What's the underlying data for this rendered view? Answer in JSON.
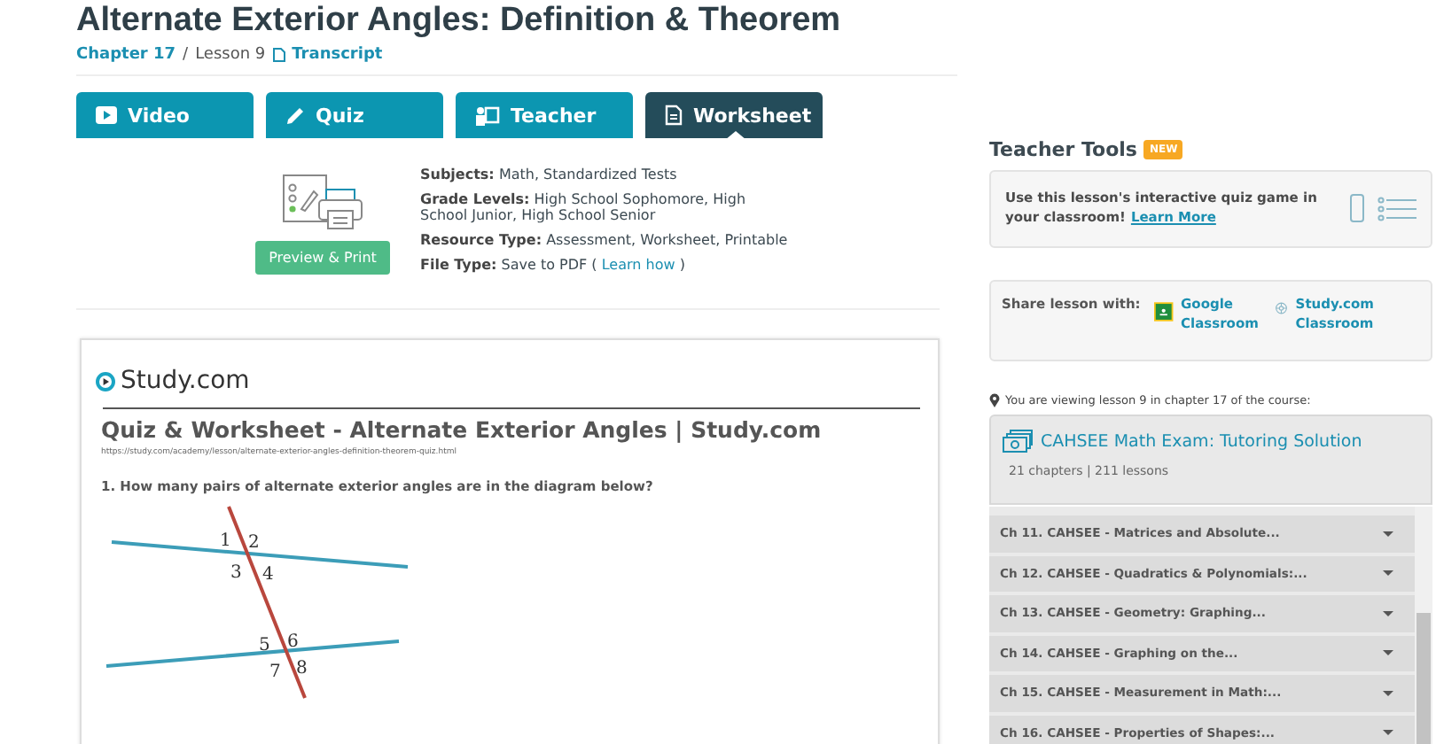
{
  "title": "Alternate Exterior Angles: Definition & Theorem",
  "breadcrumb": {
    "chapter": "Chapter 17",
    "separator": "/",
    "lesson": "Lesson 9",
    "transcript": "Transcript"
  },
  "tabs": [
    {
      "label": "Video",
      "kind": "video",
      "selected": false
    },
    {
      "label": "Quiz",
      "kind": "quiz",
      "selected": false
    },
    {
      "label": "Teacher",
      "kind": "teacher",
      "selected": false
    },
    {
      "label": "Worksheet",
      "kind": "worksheet",
      "selected": true
    }
  ],
  "resource": {
    "button": "Preview & Print",
    "fields": [
      {
        "label": "Subjects:",
        "value": "Math, Standardized Tests"
      },
      {
        "label": "Grade Levels:",
        "value": "High School Sophomore, High School Junior, High School Senior"
      },
      {
        "label": "Resource Type:",
        "value": "Assessment, Worksheet, Printable"
      },
      {
        "label": "File Type:",
        "value": "Save to PDF (",
        "link": "Learn how",
        "after": ")"
      }
    ]
  },
  "worksheet": {
    "brand": "Study.com",
    "title": "Quiz & Worksheet - Alternate Exterior Angles | Study.com",
    "url": "https://study.com/academy/lesson/alternate-exterior-angles-definition-theorem-quiz.html",
    "question": "1. How many pairs of alternate exterior angles are in the diagram below?",
    "diagram_labels": [
      "1",
      "2",
      "3",
      "4",
      "5",
      "6",
      "7",
      "8"
    ]
  },
  "teacher_tools": {
    "heading": "Teacher Tools",
    "badge": "NEW",
    "promo": {
      "text": "Use this lesson's interactive quiz game in your classroom!",
      "link": "Learn More"
    },
    "share": {
      "label": "Share lesson with:",
      "options": [
        {
          "label": "Google Classroom",
          "kind": "google"
        },
        {
          "label": "Study.com Classroom",
          "kind": "study"
        }
      ]
    }
  },
  "course": {
    "location": "You are viewing lesson 9 in chapter 17 of the course:",
    "title": "CAHSEE Math Exam: Tutoring Solution",
    "meta": "21 chapters | 211 lessons",
    "chapters": [
      {
        "label": "Ch 11. CAHSEE - Matrices and Absolute..."
      },
      {
        "label": "Ch 12. CAHSEE - Quadratics & Polynomials:..."
      },
      {
        "label": "Ch 13. CAHSEE - Geometry: Graphing..."
      },
      {
        "label": "Ch 14. CAHSEE - Graphing on the..."
      },
      {
        "label": "Ch 15. CAHSEE - Measurement in Math:..."
      },
      {
        "label": "Ch 16. CAHSEE - Properties of Shapes:..."
      }
    ]
  }
}
